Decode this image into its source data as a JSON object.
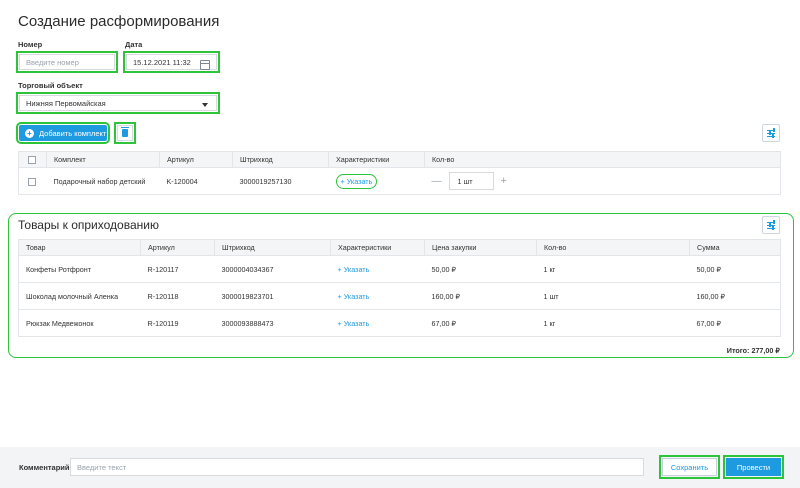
{
  "page": {
    "title": "Создание расформирования"
  },
  "form": {
    "number_label": "Номер",
    "number_placeholder": "Введите номер",
    "date_label": "Дата",
    "date_value": "15.12.2021 11:32",
    "store_label": "Торговый объект",
    "store_value": "Нижняя Первомайская"
  },
  "toolbar": {
    "add_kit_label": "Добавить комплект",
    "add_icon": "plus-circle-icon",
    "delete_icon": "trash-icon",
    "settings_icon": "settings-sliders-icon"
  },
  "kits_table": {
    "headers": [
      "Комплект",
      "Артикул",
      "Штрихкод",
      "Характеристики",
      "Кол-во"
    ],
    "rows": [
      {
        "name": "Подарочный набор детский",
        "article": "K-120004",
        "barcode": "3000019257130",
        "spec_link": "+ Указать",
        "qty": "1 шт"
      }
    ]
  },
  "goods_section": {
    "title": "Товары к оприходованию",
    "headers": [
      "Товар",
      "Артикул",
      "Штрихкод",
      "Характеристики",
      "Цена закупки",
      "Кол-во",
      "Сумма"
    ],
    "rows": [
      {
        "name": "Конфеты Ротфронт",
        "article": "R-120117",
        "barcode": "3000004034367",
        "spec_link": "+ Указать",
        "price": "50,00 ₽",
        "qty": "1 кг",
        "sum": "50,00 ₽"
      },
      {
        "name": "Шоколад молочный Аленка",
        "article": "R-120118",
        "barcode": "3000019823701",
        "spec_link": "+ Указать",
        "price": "160,00 ₽",
        "qty": "1 шт",
        "sum": "160,00 ₽"
      },
      {
        "name": "Рюкзак Медвежонок",
        "article": "R-120119",
        "barcode": "3000093888473",
        "spec_link": "+ Указать",
        "price": "67,00 ₽",
        "qty": "1 кг",
        "sum": "67,00 ₽"
      }
    ],
    "total": "Итого: 277,00 ₽"
  },
  "footer": {
    "comment_label": "Комментарий",
    "comment_placeholder": "Введите текст",
    "save_label": "Сохранить",
    "post_label": "Провести"
  },
  "colors": {
    "accent": "#1e9ae0",
    "highlight": "#2dc43a"
  }
}
